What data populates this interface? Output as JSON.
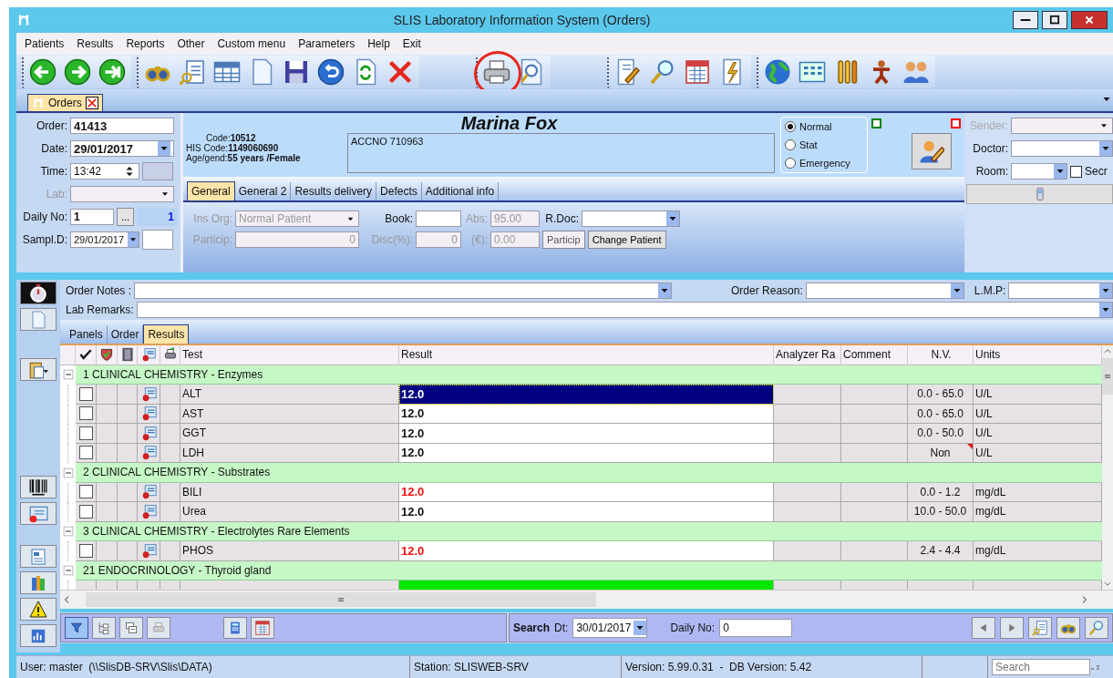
{
  "window": {
    "title": "SLIS Laboratory Information System (Orders)"
  },
  "menu": [
    "Patients",
    "Results",
    "Reports",
    "Other",
    "Custom menu",
    "Parameters",
    "Help",
    "Exit"
  ],
  "doc_tabs": [
    {
      "label": "Orders",
      "selected": true
    }
  ],
  "order": {
    "order_label": "Order:",
    "order": "41413",
    "date_label": "Date:",
    "date": "29/01/2017",
    "time_label": "Time:",
    "time": "13:42",
    "lab_label": "Lab:",
    "daily_label": "Daily No:",
    "daily": "1",
    "daily_button": "...",
    "daily_count": "1",
    "sampl_label": "Sampl.D:",
    "sampl": "29/01/2017"
  },
  "patient": {
    "name": "Marina Fox",
    "code_label": "Code:",
    "code": "10512",
    "his_label": "HIS Code:",
    "his": "1149060690",
    "age_label": "Age/gend:",
    "age": "55 years /Female",
    "notes": "ACCNO 710963"
  },
  "priority": [
    {
      "label": "Normal",
      "selected": true
    },
    {
      "label": "Stat",
      "selected": false
    },
    {
      "label": "Emergency",
      "selected": false
    }
  ],
  "flags": [
    {
      "checked": false,
      "color": "#008000"
    },
    {
      "checked": false,
      "color": "#ff0000"
    }
  ],
  "right": {
    "sender_label": "Sender:",
    "doctor_label": "Doctor:",
    "room_label": "Room:",
    "secr_label": "Secr",
    "secr_checked": false
  },
  "form_tabs": [
    {
      "label": "General",
      "selected": true
    },
    {
      "label": "General 2",
      "selected": false
    },
    {
      "label": "Results delivery",
      "selected": false
    },
    {
      "label": "Defects",
      "selected": false
    },
    {
      "label": "Additional info",
      "selected": false
    }
  ],
  "general": {
    "ins_label": "Ins Org:",
    "ins": "Normal Patient",
    "book_label": "Book:",
    "abs_label": "Abs:",
    "abs": "95.00",
    "rdoc_label": "R.Doc:",
    "particip_label": "Particip:",
    "particip": "0",
    "disc_label": "Disc(%):",
    "disc": "0",
    "cur_label": "(€):",
    "cur": "0.00",
    "particip_button": "Particip",
    "change_button": "Change Patient"
  },
  "notes": {
    "order_notes_label": "Order Notes :",
    "order_reason_label": "Order Reason:",
    "lmp_label": "L.M.P:",
    "lab_remarks_label": "Lab Remarks:"
  },
  "result_tabs": [
    {
      "label": "Panels",
      "selected": false
    },
    {
      "label": "Order",
      "selected": false
    },
    {
      "label": "Results",
      "selected": true
    }
  ],
  "columns": [
    "Test",
    "Result",
    "Analyzer Ra",
    "Comment",
    "N.V.",
    "Units"
  ],
  "groups": [
    {
      "title": "1 CLINICAL CHEMISTRY - Enzymes",
      "expanded": true,
      "rows": [
        {
          "kind": "test",
          "test": "ALT",
          "result": "12.0",
          "abnormal": false,
          "selected": true,
          "checked": false,
          "nv": "0.0 - 65.0",
          "units": "U/L",
          "nv_note": false
        },
        {
          "kind": "test",
          "test": "AST",
          "result": "12.0",
          "abnormal": false,
          "selected": false,
          "checked": false,
          "nv": "0.0 - 65.0",
          "units": "U/L",
          "nv_note": false
        },
        {
          "kind": "test",
          "test": "GGT",
          "result": "12.0",
          "abnormal": false,
          "selected": false,
          "checked": false,
          "nv": "0.0 - 50.0",
          "units": "U/L",
          "nv_note": false
        },
        {
          "kind": "test",
          "test": "LDH",
          "result": "12.0",
          "abnormal": false,
          "selected": false,
          "checked": false,
          "nv": "Non",
          "units": "U/L",
          "nv_note": true
        }
      ]
    },
    {
      "title": "2 CLINICAL CHEMISTRY - Substrates",
      "expanded": true,
      "rows": [
        {
          "kind": "test",
          "test": "BILI",
          "result": "12.0",
          "abnormal": true,
          "selected": false,
          "checked": false,
          "nv": "0.0 - 1.2",
          "units": "mg/dL",
          "nv_note": false
        },
        {
          "kind": "test",
          "test": "Urea",
          "result": "12.0",
          "abnormal": false,
          "selected": false,
          "checked": false,
          "nv": "10.0 - 50.0",
          "units": "mg/dL",
          "nv_note": false
        }
      ]
    },
    {
      "title": "3 CLINICAL CHEMISTRY - Electrolytes Rare Elements",
      "expanded": true,
      "rows": [
        {
          "kind": "test",
          "test": "PHOS",
          "result": "12.0",
          "abnormal": true,
          "selected": false,
          "checked": false,
          "nv": "2.4 - 4.4",
          "units": "mg/dL",
          "nv_note": false
        }
      ]
    },
    {
      "title": "21 ENDOCRINOLOGY - Thyroid gland",
      "expanded": true,
      "rows": [
        {
          "kind": "cut",
          "highlighted": true
        }
      ]
    }
  ],
  "bottom": {
    "filter_on": true,
    "search_label": "Search",
    "dt_label": "Dt:",
    "dt": "30/01/2017",
    "daily_label": "Daily No:",
    "daily": "0"
  },
  "status": {
    "user": "User: master  (\\\\SlisDB-SRV\\Slis\\DATA)",
    "station": "Station: SLISWEB-SRV",
    "version": "Version: 5.99.0.31  -  DB Version: 5.42",
    "search_placeholder": "Search"
  }
}
